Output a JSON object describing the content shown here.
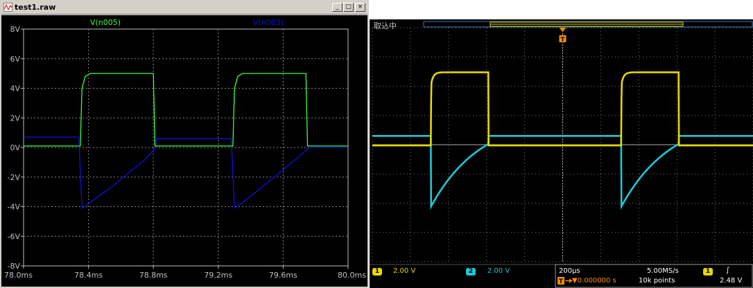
{
  "ltspice": {
    "window_title": "test1.raw",
    "buttons": {
      "minimize": "_",
      "maximize": "□",
      "close": "×"
    },
    "traces": [
      {
        "name": "V(n005)",
        "color": "#40ff40"
      },
      {
        "name": "V(n003)",
        "color": "#1010e0"
      }
    ],
    "y_ticks": [
      "8V",
      "6V",
      "4V",
      "2V",
      "0V",
      "-2V",
      "-4V",
      "-6V",
      "-8V"
    ],
    "x_ticks": [
      "78.0ms",
      "78.4ms",
      "78.8ms",
      "79.2ms",
      "79.6ms",
      "80.0ms"
    ],
    "colors": {
      "plot_bg": "#000000",
      "axis_text": "#c0c0c0",
      "grid": "#888888"
    }
  },
  "scope": {
    "status": "取込中",
    "ch1": {
      "badge": "1",
      "scale": "2.00 V",
      "color": "#e6d800"
    },
    "ch2": {
      "badge": "2",
      "scale": "2.00 V",
      "color": "#1ec8d8"
    },
    "timebase": "200µs",
    "trigger_pos": "▼0.000000 s",
    "sample_rate": "5.00MS/s",
    "record_length": "10k points",
    "trigger_source": "1",
    "trigger_slope": "∫",
    "trigger_level": "2.48 V",
    "trigger_marker": "T",
    "colors": {
      "bg": "#000000",
      "grid": "#7a7a7a",
      "trigger": "#ff8c00"
    }
  },
  "chart_data": {
    "type": "line",
    "xlabel": "",
    "ylabel": "",
    "xlim": [
      78.0,
      80.0
    ],
    "ylim": [
      -8,
      8
    ],
    "x_unit": "ms",
    "y_unit": "V",
    "series": [
      {
        "name": "V(n005)",
        "color": "#40ff40",
        "x": [
          78.0,
          78.35,
          78.36,
          78.38,
          78.41,
          78.8,
          78.81,
          79.0,
          79.2,
          79.29,
          79.3,
          79.32,
          79.35,
          79.74,
          79.75,
          80.0
        ],
        "y": [
          0.1,
          0.1,
          4.0,
          4.8,
          5.0,
          5.0,
          0.1,
          0.1,
          0.1,
          0.1,
          4.0,
          4.8,
          5.0,
          5.0,
          0.1,
          0.1
        ]
      },
      {
        "name": "V(n003)",
        "color": "#1010e0",
        "x": [
          78.0,
          78.34,
          78.36,
          78.45,
          78.55,
          78.65,
          78.75,
          78.81,
          78.82,
          79.0,
          79.28,
          79.3,
          79.4,
          79.5,
          79.6,
          79.7,
          79.75,
          79.76,
          80.0
        ],
        "y": [
          0.7,
          0.7,
          -4.1,
          -3.4,
          -2.6,
          -1.7,
          -0.8,
          -0.1,
          0.6,
          0.6,
          0.6,
          -4.1,
          -3.3,
          -2.4,
          -1.5,
          -0.6,
          -0.1,
          0.0,
          0.0
        ]
      }
    ]
  }
}
